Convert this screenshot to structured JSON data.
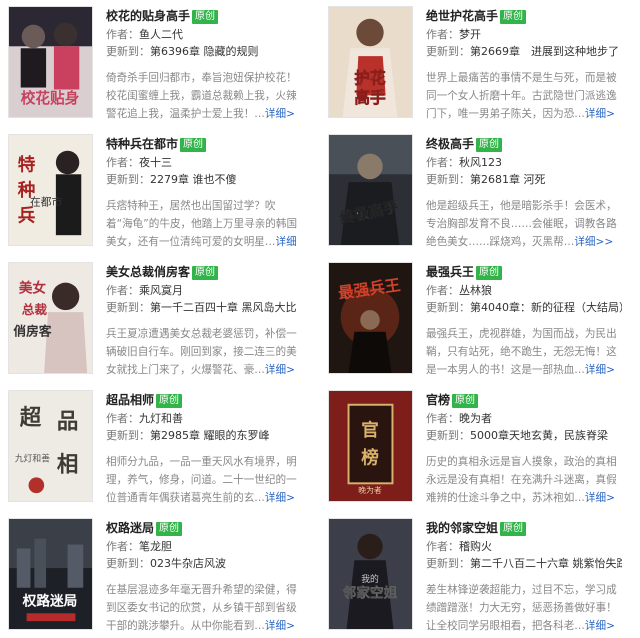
{
  "labels": {
    "author_prefix": "作者：",
    "update_prefix": "更新到：",
    "badge": "原创",
    "more": "详细>>"
  },
  "books": [
    {
      "title": "校花的贴身高手",
      "author": "鱼人二代",
      "latest": "第6396章 隐藏的规则",
      "desc": "倚奇杀手回归都市，奉旨泡妞保护校花！校花闺蜜缠上我，霸道总裁赖上我，火辣警花追上我，温柔护士爱上我！…",
      "cover_text": "校花的贴身高手",
      "cover_colors": [
        "#2b2733",
        "#c9415f"
      ]
    },
    {
      "title": "绝世护花高手",
      "author": "梦开",
      "latest": "第2669章　进展到这种地步了",
      "desc": "世界上最痛苦的事情不是生与死，而是被同一个女人折磨十年。古武隐世门派逃逸门下，唯一男弟子陈关，因为恐…",
      "cover_text": "护花高手",
      "cover_colors": [
        "#e9dccb",
        "#b8322b"
      ]
    },
    {
      "title": "特种兵在都市",
      "author": "夜十三",
      "latest": "2279章 谁也不傻",
      "desc": "兵痞特种王，居然也出国留过学？吹着“海龟”的牛皮，他踏上万里寻亲的韩国美女，还有一位清纯可爱的女明星…",
      "cover_text": "特种兵在都市",
      "cover_colors": [
        "#f1ece2",
        "#a62120"
      ]
    },
    {
      "title": "终极高手",
      "author": "秋风123",
      "latest": "第2681章 河死",
      "desc": "他是超级兵王，他是暗影杀手！会医术，专治胸部发育不良……会催眠，调教各路绝色美女……踩烧鸡，灭黑帮…",
      "cover_text": "终极高手",
      "cover_colors": [
        "#2c3036",
        "#7a8a94"
      ]
    },
    {
      "title": "美女总裁俏房客",
      "author": "乘风寞月",
      "latest": "第一千二百四十章 黑风岛大比",
      "desc": "兵王夏凉遭遇美女总裁老婆惩罚，补偿一辆破旧自行车。刚回到家，接二连三的美女就找上门来了，火爆警花、豪…",
      "cover_text": "美女总裁俏房客",
      "cover_colors": [
        "#efe9e4",
        "#b0323f"
      ]
    },
    {
      "title": "最强兵王",
      "author": "丛林狼",
      "latest": "第4040章：新的征程（大结局）",
      "desc": "最强兵王，虎视群雄，为国而战，为民出鞘，只有站死，绝不跪生，无怨无悔！这是一本男人的书！这是一部热血…",
      "cover_text": "最强兵王",
      "cover_colors": [
        "#1f1612",
        "#d2412a"
      ]
    },
    {
      "title": "超品相师",
      "author": "九灯和善",
      "latest": "第2985章 耀眼的东罗峰",
      "desc": "相师分九品，一品一重天风水有境界，明理，养气，修身，问道。二十一世纪的一位普通青年偶获诸葛亮生前的玄…",
      "cover_text": "超品相师",
      "cover_colors": [
        "#eeeae4",
        "#3e3a36"
      ]
    },
    {
      "title": "官榜",
      "author": "晚为者",
      "latest": "5000章天地玄黄，民族脊梁",
      "desc": "历史的真相永远是盲人摸象，政治的真相永远是没有真相！在充满升斗迷离，真假难辨的仕途斗争之中，苏沐袍如…",
      "cover_text": "官榜",
      "cover_colors": [
        "#7d1e1a",
        "#d8b26a"
      ]
    },
    {
      "title": "权路迷局",
      "author": "笔龙胆",
      "latest": "023牛杂店风波",
      "desc": "在基层混迹多年毫无晋升希望的梁健，得到区委女书记的欣赏，从乡镇干部到省级干部的跳涉攀升。从中你能看到…",
      "cover_text": "权路迷局",
      "cover_colors": [
        "#1d2026",
        "#b62c2c"
      ]
    },
    {
      "title": "我的邻家空姐",
      "author": "稽购火",
      "latest": "第二千八百二十六章 姚紫怡失踪",
      "desc": "差生林锋逆袭超能力，过目不忘，学习成绩蹭蹭涨！力大无穷，惩恶扬善做好事！让全校同学另眼相看，把各科老…",
      "cover_text": "我的邻家空姐",
      "cover_colors": [
        "#3c3f49",
        "#c9ccd6"
      ]
    }
  ]
}
